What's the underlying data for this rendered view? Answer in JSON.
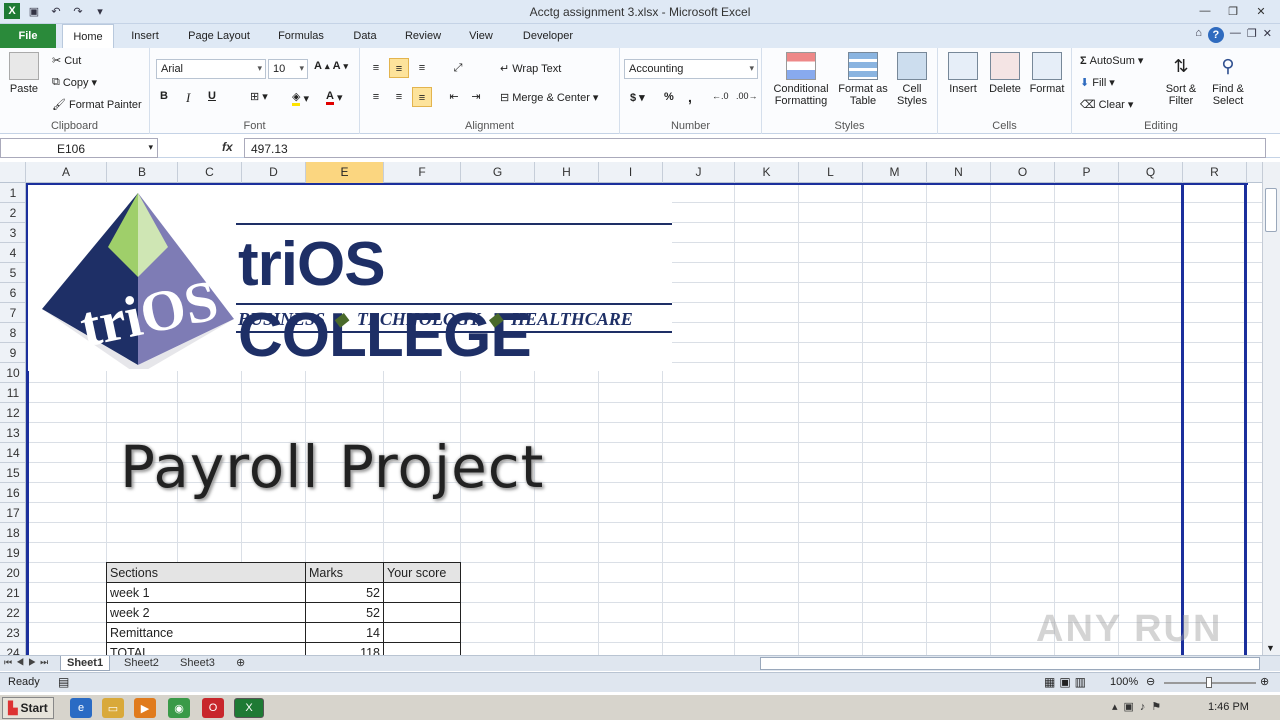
{
  "app": {
    "title": "Acctg assignment 3.xlsx - Microsoft Excel"
  },
  "tabs": [
    "File",
    "Home",
    "Insert",
    "Page Layout",
    "Formulas",
    "Data",
    "Review",
    "View",
    "Developer"
  ],
  "clipboard": {
    "paste": "Paste",
    "cut": "Cut",
    "copy": "Copy",
    "format_painter": "Format Painter",
    "label": "Clipboard"
  },
  "font": {
    "name": "Arial",
    "size": "10",
    "label": "Font",
    "bold": "B",
    "italic": "I",
    "underline": "U"
  },
  "alignment": {
    "wrap": "Wrap Text",
    "merge": "Merge & Center",
    "label": "Alignment"
  },
  "number": {
    "format": "Accounting",
    "currency": "$",
    "percent": "%",
    "comma": ",",
    "label": "Number"
  },
  "styles": {
    "conditional": "Conditional Formatting",
    "format_table": "Format as Table",
    "cell_styles": "Cell Styles",
    "label": "Styles"
  },
  "cells": {
    "insert": "Insert",
    "delete": "Delete",
    "format": "Format",
    "label": "Cells"
  },
  "editing": {
    "autosum": "AutoSum",
    "fill": "Fill",
    "clear": "Clear",
    "sort": "Sort & Filter",
    "find": "Find & Select",
    "label": "Editing"
  },
  "formula_bar": {
    "name_box": "E106",
    "fx": "fx",
    "value": "497.13"
  },
  "columns": [
    "A",
    "B",
    "C",
    "D",
    "E",
    "F",
    "G",
    "H",
    "I",
    "J",
    "K",
    "L",
    "M",
    "N",
    "O",
    "P",
    "Q",
    "R"
  ],
  "rows": [
    "1",
    "2",
    "3",
    "4",
    "5",
    "6",
    "7",
    "8",
    "9",
    "10",
    "11",
    "12",
    "13",
    "14",
    "15",
    "16",
    "17",
    "18",
    "19",
    "20",
    "21",
    "22",
    "23",
    "24"
  ],
  "logo": {
    "name": "triOS COLLEGE",
    "mark": "triOS",
    "tagline": [
      "BUSINESS",
      "TECHNOLOGY",
      "HEALTHCARE"
    ]
  },
  "sheet_title": "Payroll Project",
  "marks_table": {
    "headers": [
      "Sections",
      "Marks",
      "Your score"
    ],
    "rows": [
      [
        "week 1",
        "52",
        ""
      ],
      [
        "week 2",
        "52",
        ""
      ],
      [
        "Remittance",
        "14",
        ""
      ],
      [
        "TOTAL",
        "118",
        ""
      ]
    ]
  },
  "sheets": [
    "Sheet1",
    "Sheet2",
    "Sheet3"
  ],
  "status": {
    "ready": "Ready",
    "zoom": "100%"
  },
  "taskbar": {
    "start": "Start",
    "time": "1:46 PM"
  },
  "watermark": "ANY RUN"
}
